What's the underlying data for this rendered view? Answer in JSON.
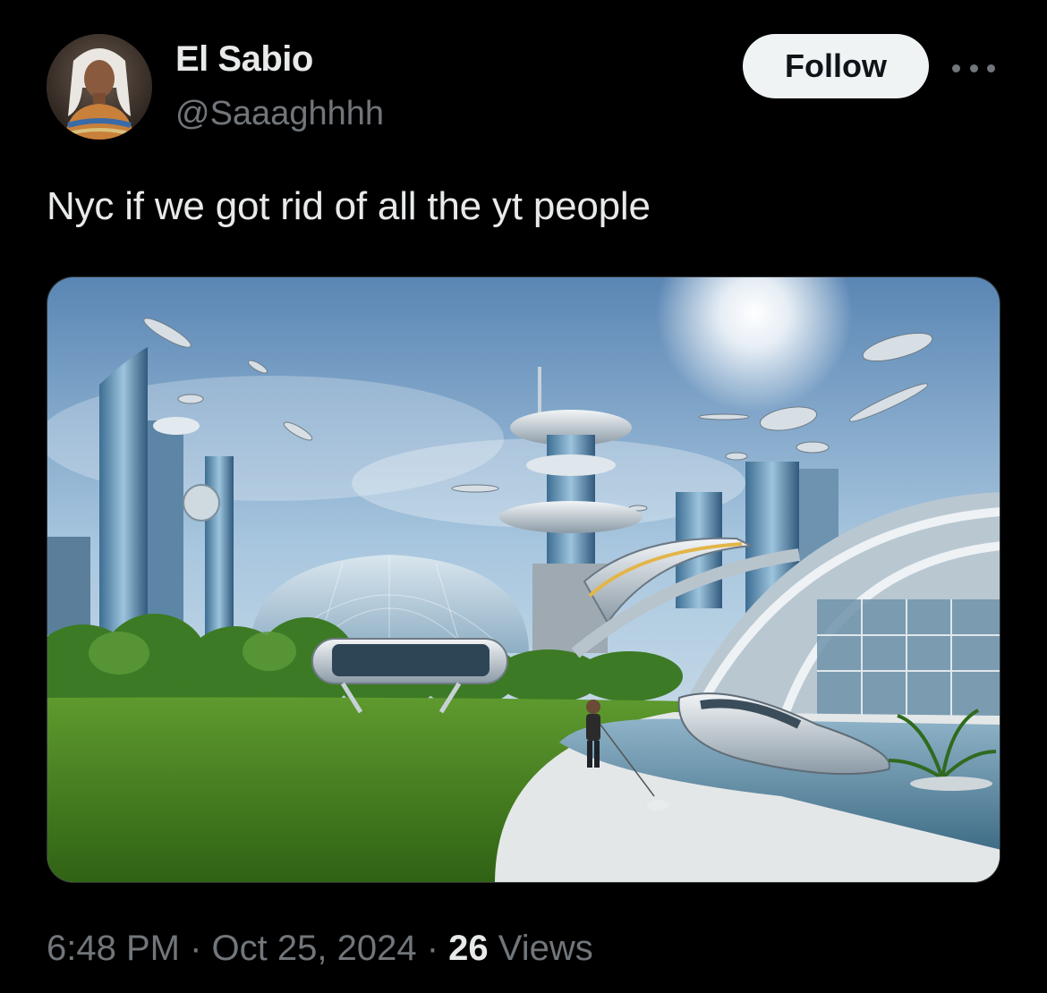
{
  "author": {
    "display_name": "El Sabio",
    "handle": "@Saaaghhhh",
    "avatar_icon": "profile-avatar"
  },
  "actions": {
    "follow_label": "Follow",
    "more_icon": "more-horizontal-icon"
  },
  "tweet": {
    "text": "Nyc if we got rid of all the yt people"
  },
  "meta": {
    "time": "6:48 PM",
    "separator": "·",
    "date": "Oct 25, 2024",
    "views_count": "26",
    "views_label": "Views"
  },
  "colors": {
    "background": "#000000",
    "primary_text": "#e7e9ea",
    "secondary_text": "#71767b",
    "follow_button_bg": "#eff3f4",
    "follow_button_text": "#0f1419"
  }
}
